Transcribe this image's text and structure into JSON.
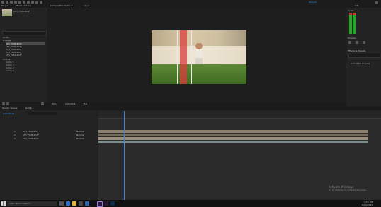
{
  "app": {
    "accent": "#2d8ceb",
    "workspace_label": "Default"
  },
  "project": {
    "tab": "Project",
    "effects_tab": "Effect Controls",
    "selected_name": "MVI_7048.MOV",
    "items": [
      {
        "label": "Solids"
      },
      {
        "label": "footage"
      },
      {
        "label": "MVI_7048.MOV"
      },
      {
        "label": "MVI_7049.MOV"
      },
      {
        "label": "MVI_7050.MOV"
      },
      {
        "label": "MVI_7051.MOV"
      },
      {
        "label": "MVI_7052.MOV"
      },
      {
        "label": "Comps"
      },
      {
        "label": "Comp 1"
      },
      {
        "label": "Comp 2"
      },
      {
        "label": "Comp 3"
      },
      {
        "label": "Comp 4"
      }
    ]
  },
  "composition": {
    "tab": "Composition Comp 1",
    "layer_tab": "Layer",
    "footer_zoom": "50%",
    "footer_time": "0:00:00:12",
    "footer_res": "Full"
  },
  "right_panel": {
    "tab": "Info",
    "audio_tab": "Audio",
    "preview_tab": "Preview",
    "effects_tab": "Effects & Presets",
    "search_placeholder": "",
    "item_label": "Animation Presets"
  },
  "timeline": {
    "tab": "Comp 1",
    "render_tab": "Render Queue",
    "timecode": "0:00:00:12",
    "layers": [
      {
        "num": "1",
        "name": "MVI_7048.MOV",
        "mode": "Normal"
      },
      {
        "num": "2",
        "name": "MVI_7048.MOV",
        "mode": "Normal"
      },
      {
        "num": "3",
        "name": "MVI_7048.MOV",
        "mode": "Normal"
      }
    ],
    "playhead_fraction": 0.09
  },
  "watermark": {
    "title": "Activate Windows",
    "subtitle": "Go to Settings to activate Windows."
  },
  "taskbar": {
    "search_placeholder": "Type here to search",
    "time": "4:55 PM",
    "date": "6/19/2019"
  }
}
